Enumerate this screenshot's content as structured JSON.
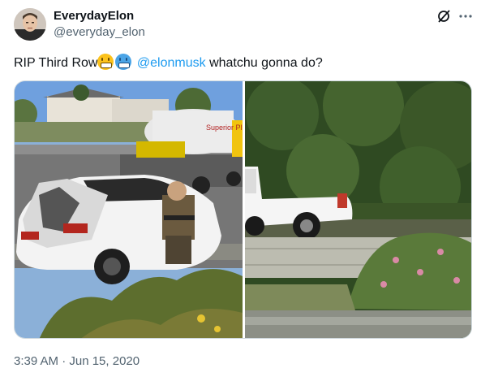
{
  "author": {
    "display_name": "EverydayElon",
    "handle": "@everyday_elon"
  },
  "tweet": {
    "text_before": "RIP Third Row",
    "mention": "@elonmusk",
    "text_after": " whatchu gonna do?"
  },
  "media": [
    {
      "description_icon": "crashed-car-photo"
    },
    {
      "description_icon": "pickup-truck-photo"
    }
  ],
  "timestamp": "3:39 AM · Jun 15, 2020",
  "icons": {
    "grok": "grok-icon",
    "more": "more-options-icon"
  },
  "colors": {
    "link": "#1d9bf0",
    "secondary_text": "#536471"
  }
}
